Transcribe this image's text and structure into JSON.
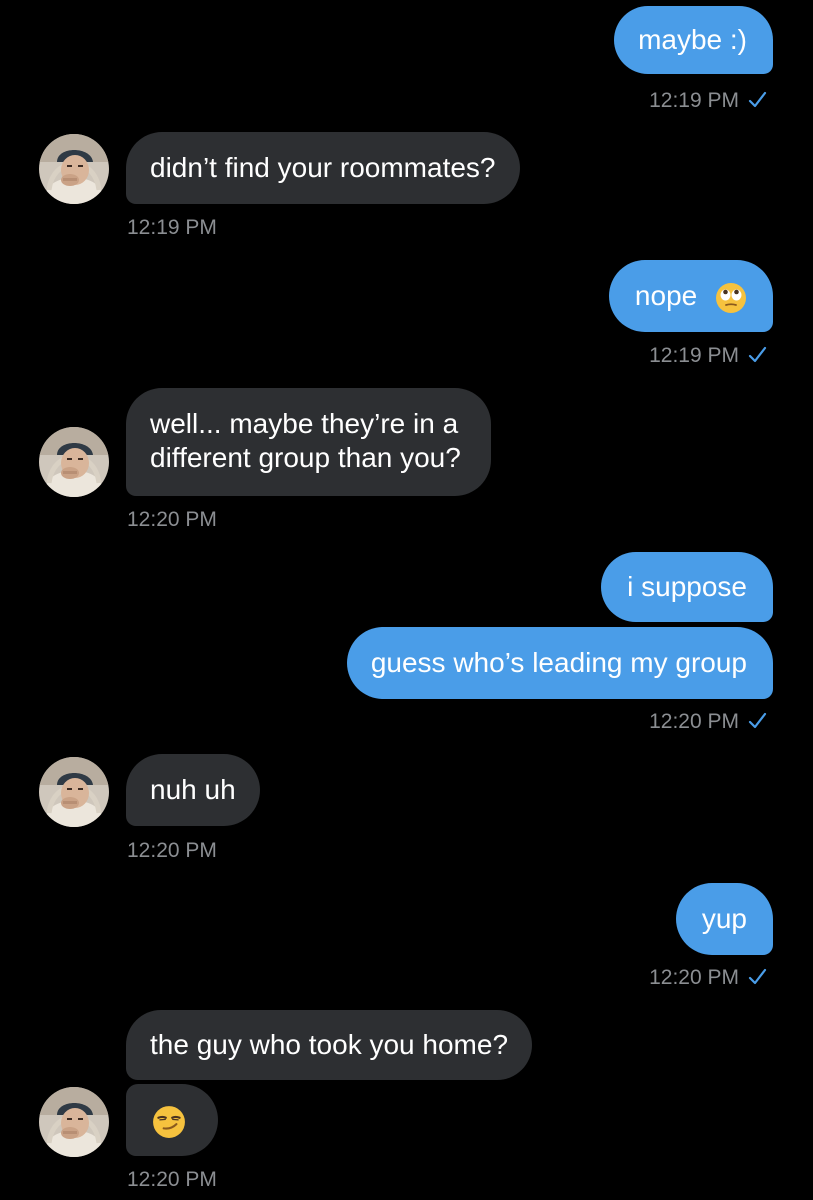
{
  "messages": [
    {
      "side": "out",
      "text": "maybe :)"
    },
    {
      "side": "out",
      "time": "12:19 PM"
    },
    {
      "side": "in",
      "text": "didn’t find your roommates?",
      "time": "12:19 PM"
    },
    {
      "side": "out",
      "text": "nope",
      "emoji": "rolling-eyes-emoji",
      "time": "12:19 PM"
    },
    {
      "side": "in",
      "lines": [
        "well... maybe they’re in a",
        "different group than you?"
      ],
      "time": "12:20 PM"
    },
    {
      "side": "out",
      "text": "i suppose"
    },
    {
      "side": "out",
      "text": "guess who’s leading my group",
      "time": "12:20 PM"
    },
    {
      "side": "in",
      "text": "nuh uh",
      "time": "12:20 PM"
    },
    {
      "side": "out",
      "text": "yup",
      "time": "12:20 PM"
    },
    {
      "side": "in",
      "text": "the guy who took you home?"
    },
    {
      "side": "in",
      "emoji": "smirking-face-emoji",
      "time": "12:20 PM"
    }
  ],
  "colors": {
    "background": "#000000",
    "outgoing_bubble": "#4a9de8",
    "incoming_bubble": "#2d2f32",
    "timestamp": "#8b8e92",
    "read_check": "#4a9de8"
  },
  "icons": {
    "read_receipt": "checkmark-icon",
    "avatar": "contact-avatar"
  }
}
